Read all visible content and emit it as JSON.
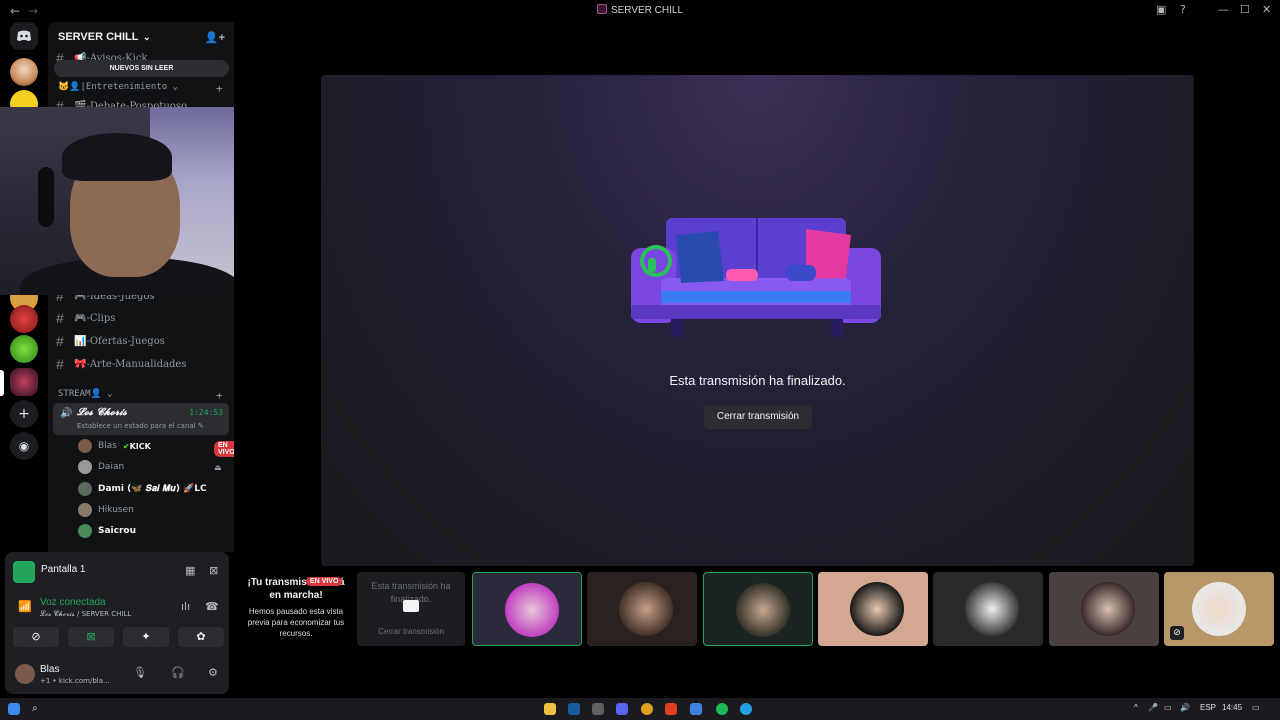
{
  "titlebar": {
    "title": "SERVER CHILL",
    "back_icon": "←",
    "forward_icon": "→",
    "min_icon": "—",
    "max_icon": "☐",
    "close_icon": "✕"
  },
  "server": {
    "name": "SERVER CHILL",
    "unread_pill": "NUEVOS SIN LEER"
  },
  "channels_top": [
    {
      "label": "📢-Avisos-Kick"
    }
  ],
  "category_entretenimiento": "🐱👤|Entretenimiento",
  "channels_mid": [
    {
      "label": "🎬-Debate-Pospotuoso"
    },
    {
      "label": "🎮-Ideas-Juegos"
    },
    {
      "label": "🎮-Clips"
    },
    {
      "label": "📊-Ofertas-Juegos"
    },
    {
      "label": "🎀-Arte-Manualidades"
    }
  ],
  "category_stream": "STREAM👤",
  "voice_channel": {
    "name": "𝓛𝓸𝓼 𝓒𝓱𝓸𝓻𝓲𝓼",
    "timer": "1:24:53",
    "status_hint": "Establece un estado para el canal"
  },
  "members": [
    {
      "name": "Blas",
      "tag": "KICK",
      "live": "EN VIVO"
    },
    {
      "name": "Daian"
    },
    {
      "name": "Dami (🦋 𝑺𝒂𝒊 𝑴𝒖) 🚀LC"
    },
    {
      "name": "Hikusen"
    },
    {
      "name": "Saicrou"
    }
  ],
  "stage": {
    "ended_message": "Esta transmisión ha finalizado.",
    "close_button": "Cerrar transmisión"
  },
  "paused_card": {
    "title": "¡Tu transmisión está en marcha!",
    "badge": "EN VIVO",
    "description": "Hemos pausado esta vista previa para economizar tus recursos."
  },
  "self_preview": {
    "title": "Esta transmisión ha finalizado.",
    "button": "Cerrar transmisión"
  },
  "panel": {
    "screen_label": "Pantalla 1",
    "voice_status": "Voz conectada",
    "voice_sub": "𝓛𝓸𝓼 𝓒𝓱𝓸𝓻𝓲𝓼 / SERVER CHILL",
    "username": "Blas",
    "user_status": "+1 • kick.com/bla..."
  },
  "taskbar": {
    "lang": "ESP",
    "time": "14:45"
  },
  "colors": {
    "accent_green": "#23a55a",
    "live_red": "#da373c",
    "bg": "#000000"
  }
}
